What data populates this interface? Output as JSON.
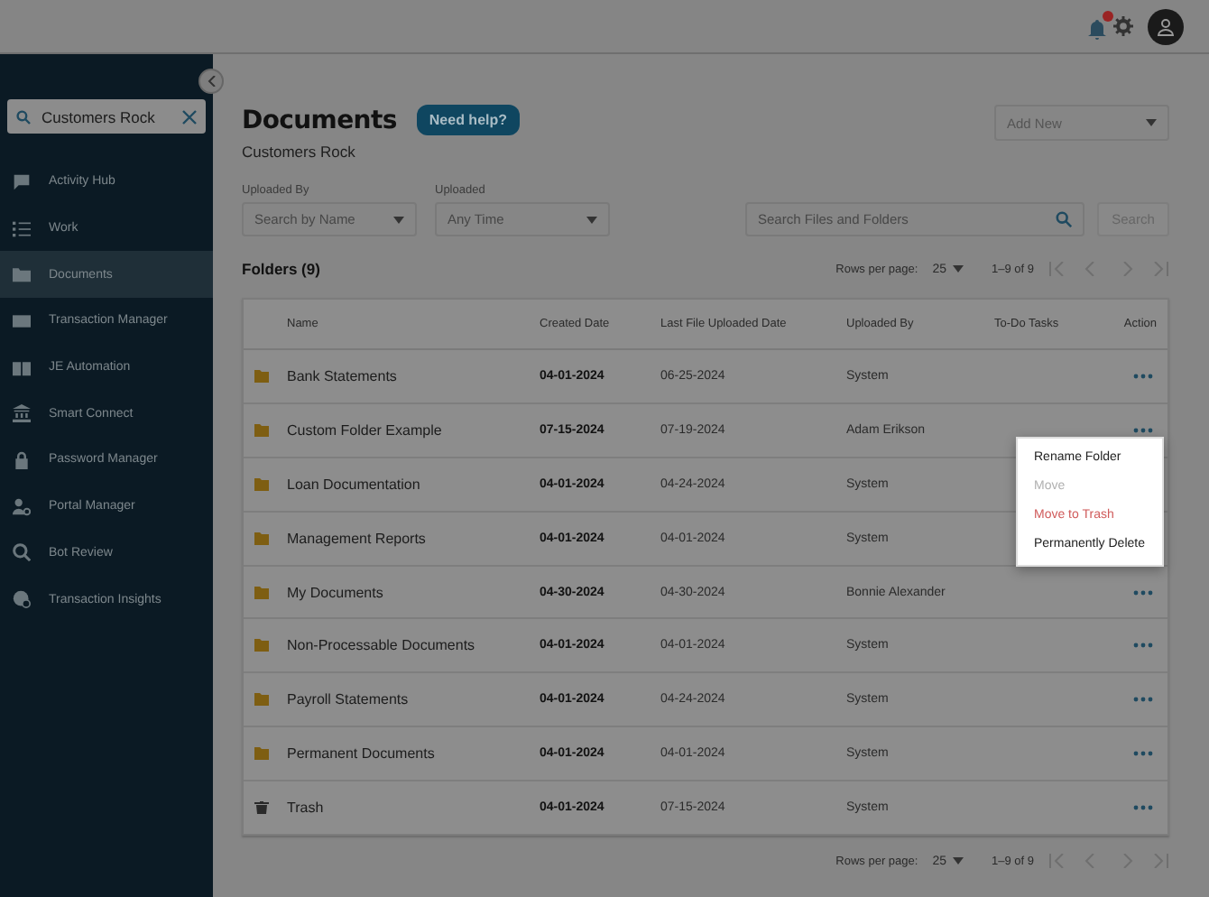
{
  "header": {
    "notifications": true
  },
  "sidebar": {
    "search": {
      "value": "Customers Rock"
    },
    "items": [
      {
        "label": "Activity Hub",
        "selected": false
      },
      {
        "label": "Work",
        "selected": false
      },
      {
        "label": "Documents",
        "selected": true
      },
      {
        "label": "Transaction Manager",
        "selected": false
      },
      {
        "label": "JE Automation",
        "selected": false
      },
      {
        "label": "Smart Connect",
        "selected": false
      },
      {
        "label": "Password Manager",
        "selected": false
      },
      {
        "label": "Portal Manager",
        "selected": false
      },
      {
        "label": "Bot Review",
        "selected": false
      },
      {
        "label": "Transaction Insights",
        "selected": false
      }
    ]
  },
  "page": {
    "title": "Documents",
    "help_button": "Need help?",
    "subtitle": "Customers Rock",
    "add_new": "Add New"
  },
  "filters": [
    {
      "label": "Uploaded By",
      "placeholder": "Search by Name"
    },
    {
      "label": "Uploaded",
      "placeholder": "Any Time"
    }
  ],
  "search": {
    "placeholder": "Search Files and Folders",
    "button": "Search"
  },
  "folders_heading": "Folders (9)",
  "pagination": [
    {
      "rows_label": "Rows per page:",
      "rows_value": "25",
      "range": "1–9 of 9"
    },
    {
      "rows_label": "Rows per page:",
      "rows_value": "25",
      "range": "1–9 of 9"
    }
  ],
  "table": {
    "columns": [
      "Name",
      "Created Date",
      "Last File Uploaded Date",
      "Uploaded By",
      "To-Do Tasks",
      "Action"
    ],
    "rows": [
      {
        "kind": "folder",
        "name": "Bank Statements",
        "created": "04-01-2024",
        "last_upload": "06-25-2024",
        "uploaded_by": "System",
        "menu_open": false
      },
      {
        "kind": "folder",
        "name": "Custom Folder Example",
        "created": "07-15-2024",
        "last_upload": "07-19-2024",
        "uploaded_by": "Adam Erikson",
        "menu_open": true
      },
      {
        "kind": "folder",
        "name": "Loan Documentation",
        "created": "04-01-2024",
        "last_upload": "04-24-2024",
        "uploaded_by": "System",
        "menu_open": false
      },
      {
        "kind": "folder",
        "name": "Management Reports",
        "created": "04-01-2024",
        "last_upload": "04-01-2024",
        "uploaded_by": "System",
        "menu_open": false
      },
      {
        "kind": "folder",
        "name": "My Documents",
        "created": "04-30-2024",
        "last_upload": "04-30-2024",
        "uploaded_by": "Bonnie Alexander",
        "menu_open": false
      },
      {
        "kind": "folder",
        "name": "Non-Processable Documents",
        "created": "04-01-2024",
        "last_upload": "04-01-2024",
        "uploaded_by": "System",
        "menu_open": false
      },
      {
        "kind": "folder",
        "name": "Payroll Statements",
        "created": "04-01-2024",
        "last_upload": "04-24-2024",
        "uploaded_by": "System",
        "menu_open": false
      },
      {
        "kind": "folder",
        "name": "Permanent Documents",
        "created": "04-01-2024",
        "last_upload": "04-01-2024",
        "uploaded_by": "System",
        "menu_open": false
      },
      {
        "kind": "trash",
        "name": "Trash",
        "created": "04-01-2024",
        "last_upload": "07-15-2024",
        "uploaded_by": "System",
        "menu_open": false
      }
    ]
  },
  "context_menu": [
    {
      "label": "Rename Folder",
      "kind": "normal",
      "disabled": false
    },
    {
      "label": "Move",
      "kind": "normal",
      "disabled": true
    },
    {
      "label": "Move to Trash",
      "kind": "danger",
      "disabled": false
    },
    {
      "label": "Permanently Delete",
      "kind": "normal",
      "disabled": false
    }
  ]
}
